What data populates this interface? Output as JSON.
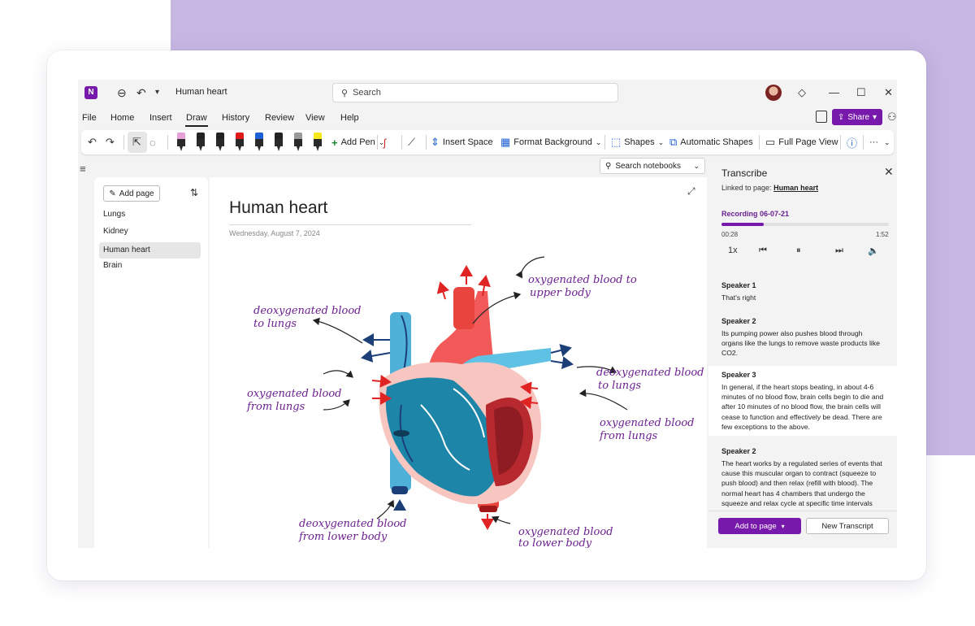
{
  "titlebar": {
    "app_logo": "N",
    "back_icon": "⊖",
    "undo_icon": "↶",
    "dropdown_icon": "▾",
    "doc_title": "Human heart",
    "search_placeholder": "Search",
    "minimize": "—",
    "maximize": "☐",
    "close": "✕"
  },
  "menu": {
    "items": [
      "File",
      "Home",
      "Insert",
      "Draw",
      "History",
      "Review",
      "View",
      "Help"
    ],
    "active": "Draw",
    "share_label": "Share"
  },
  "ribbon": {
    "add_pen": "Add Pen",
    "insert_space": "Insert Space",
    "format_background": "Format Background",
    "shapes": "Shapes",
    "automatic_shapes": "Automatic Shapes",
    "full_page_view": "Full Page View",
    "more": "···",
    "pen_colors": [
      "#e8a0d8",
      "#222222",
      "#222222",
      "#e01b1b",
      "#1f5fd6",
      "#222222",
      "#9a9a9a",
      "#f7e81a"
    ]
  },
  "left_pane": {
    "add_page": "Add page",
    "pages": [
      "Lungs",
      "Kidney",
      "Human heart",
      "Brain"
    ],
    "selected": "Human heart"
  },
  "search_notebooks": "Search notebooks",
  "note": {
    "title": "Human heart",
    "date": "Wednesday, August 7, 2024",
    "labels": {
      "upper_1": "oxygenated blood to",
      "upper_2": "upper body",
      "deoxy_lungs_l1": "deoxygenated blood",
      "deoxy_lungs_l2": "to lungs",
      "oxy_lungs_l1": "oxygenated blood",
      "oxy_lungs_l2": "from lungs",
      "deoxy_lungs_r1": "deoxygenated blood",
      "deoxy_lungs_r2": "to lungs",
      "oxy_lungs_r1": "oxygenated blood",
      "oxy_lungs_r2": "from lungs",
      "lower_in_1": "deoxygenated blood",
      "lower_in_2": "from lower body",
      "lower_out_1": "oxygenated blood",
      "lower_out_2": "to lower body"
    }
  },
  "transcribe": {
    "title": "Transcribe",
    "linked_prefix": "Linked to page:",
    "linked_page": "Human heart",
    "recording": "Recording 06-07-21",
    "progress": 0.25,
    "time_current": "00:28",
    "time_total": "1:52",
    "speed": "1x",
    "segments": [
      {
        "speaker": "Speaker 1",
        "text": "That's right"
      },
      {
        "speaker": "Speaker 2",
        "text": "Its pumping power also pushes blood through organs like the lungs to remove waste products like CO2."
      },
      {
        "speaker": "Speaker 3",
        "text": "In general, if the heart stops beating, in about 4-6 minutes of no blood flow, brain cells begin to die and after 10 minutes of no blood flow, the brain cells will cease to function and effectively be dead. There are few exceptions to the above."
      },
      {
        "speaker": "Speaker 2",
        "text": "The heart works by a regulated series of events that cause this muscular organ to contract (squeeze to push blood) and then relax (refill with blood). The normal heart has 4 chambers that undergo the squeeze and relax cycle at specific time intervals"
      }
    ],
    "add_to_page": "Add to page",
    "new_transcript": "New Transcript"
  }
}
